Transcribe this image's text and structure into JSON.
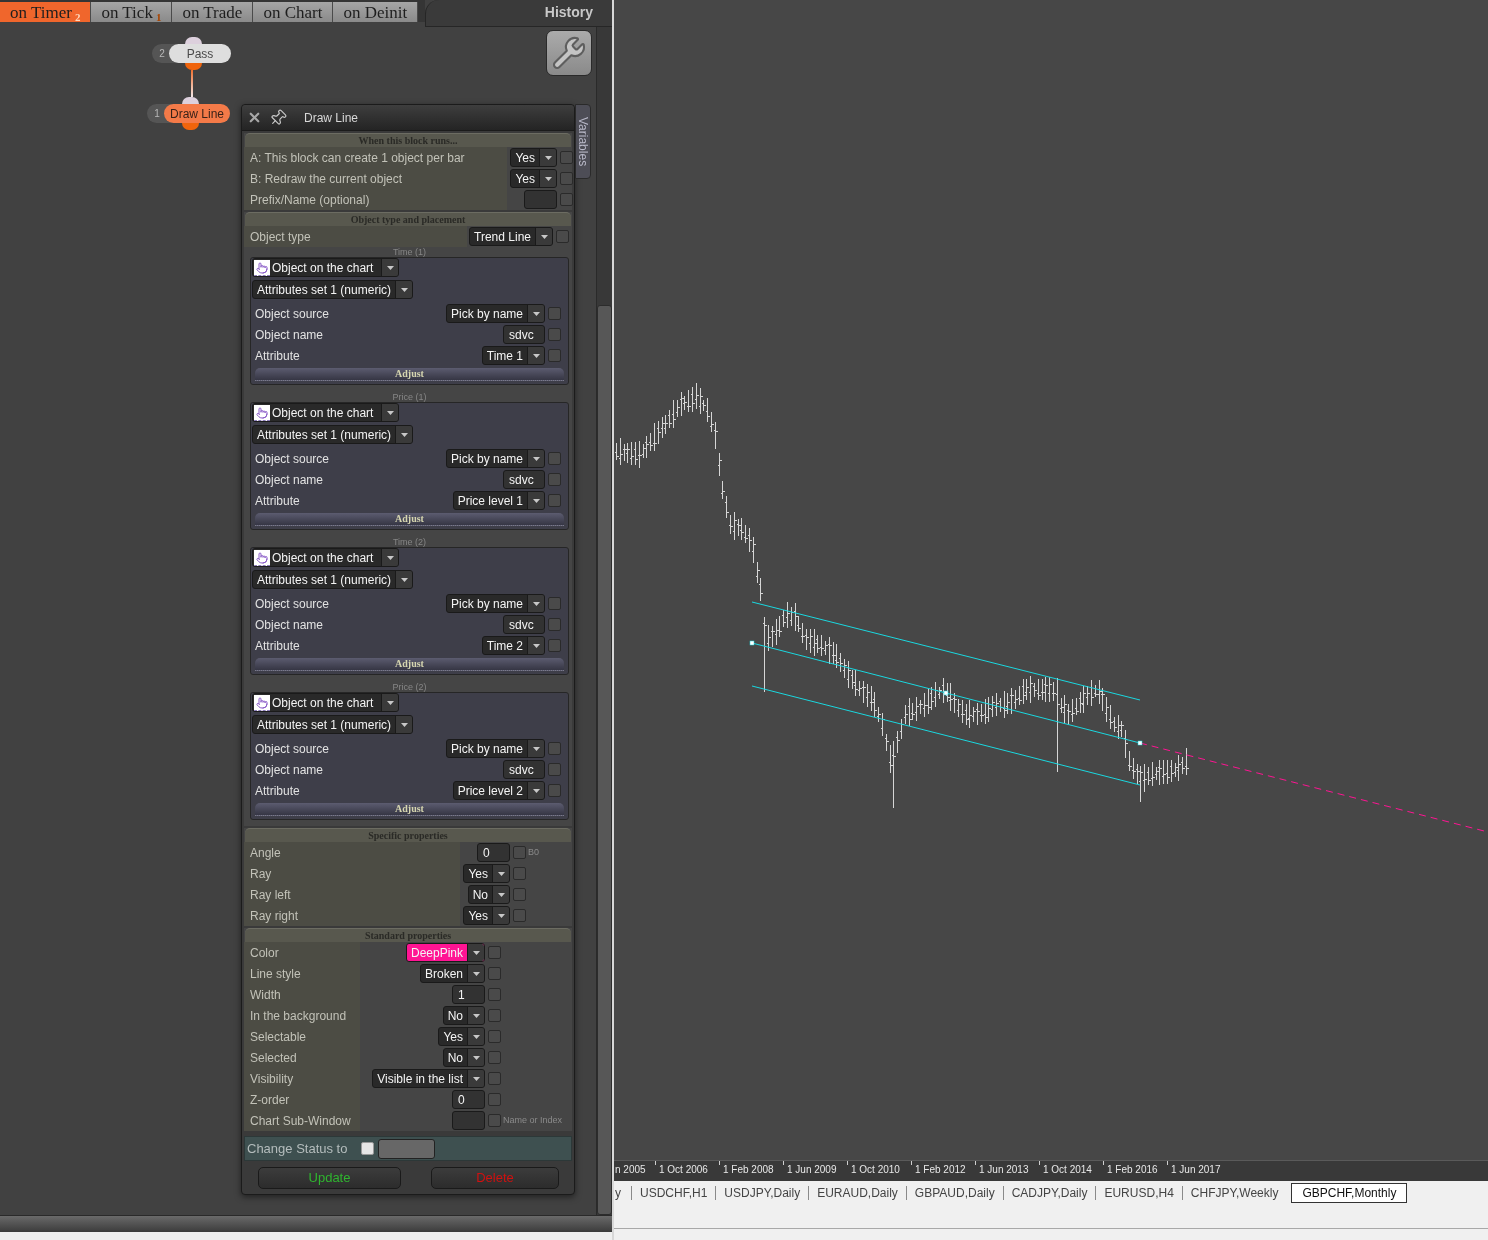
{
  "event_tabs": [
    {
      "label": "on Timer",
      "count": "2",
      "selected": true
    },
    {
      "label": "on Tick",
      "count": "1",
      "selected": false
    },
    {
      "label": "on Trade",
      "selected": false
    },
    {
      "label": "on Chart",
      "selected": false
    },
    {
      "label": "on Deinit",
      "selected": false
    }
  ],
  "history": {
    "title": "History"
  },
  "flow_nodes": [
    {
      "number": "2",
      "label": "Pass",
      "selected": false
    },
    {
      "number": "1",
      "label": "Draw Line",
      "selected": true
    }
  ],
  "block_panel": {
    "title": "Draw Line",
    "side_tab": "Variables",
    "sections": [
      {
        "title": "When this block runs...",
        "rows": [
          {
            "kind": "dropdown",
            "label": "A: This block can create 1 object per bar",
            "value": "Yes",
            "checked": false
          },
          {
            "kind": "dropdown",
            "label": "B: Redraw the current object",
            "value": "Yes",
            "checked": false
          },
          {
            "kind": "input",
            "label": "Prefix/Name (optional)",
            "checked": false
          }
        ]
      },
      {
        "title": "Object type and placement",
        "rows": [
          {
            "kind": "dropdown",
            "label": "Object type",
            "value": "Trend Line",
            "checked": false
          }
        ],
        "groups": [
          {
            "caption": "Time (1)",
            "source": "Object on the chart",
            "set": "Attributes set 1 (numeric)",
            "rows": [
              {
                "kind": "dropdown",
                "label": "Object source",
                "value": "Pick by name",
                "checked": false
              },
              {
                "kind": "input",
                "label": "Object name",
                "value": "sdvc",
                "checked": false
              },
              {
                "kind": "dropdown",
                "label": "Attribute",
                "value": "Time 1",
                "checked": false
              }
            ],
            "action": "Adjust"
          },
          {
            "caption": "Price (1)",
            "source": "Object on the chart",
            "set": "Attributes set 1 (numeric)",
            "rows": [
              {
                "kind": "dropdown",
                "label": "Object source",
                "value": "Pick by name",
                "checked": false
              },
              {
                "kind": "input",
                "label": "Object name",
                "value": "sdvc",
                "checked": false
              },
              {
                "kind": "dropdown",
                "label": "Attribute",
                "value": "Price level 1",
                "checked": false
              }
            ],
            "action": "Adjust"
          },
          {
            "caption": "Time (2)",
            "source": "Object on the chart",
            "set": "Attributes set 1 (numeric)",
            "rows": [
              {
                "kind": "dropdown",
                "label": "Object source",
                "value": "Pick by name",
                "checked": false
              },
              {
                "kind": "input",
                "label": "Object name",
                "value": "sdvc",
                "checked": false
              },
              {
                "kind": "dropdown",
                "label": "Attribute",
                "value": "Time 2",
                "checked": false
              }
            ],
            "action": "Adjust"
          },
          {
            "caption": "Price (2)",
            "source": "Object on the chart",
            "set": "Attributes set 1 (numeric)",
            "rows": [
              {
                "kind": "dropdown",
                "label": "Object source",
                "value": "Pick by name",
                "checked": false
              },
              {
                "kind": "input",
                "label": "Object name",
                "value": "sdvc",
                "checked": false
              },
              {
                "kind": "dropdown",
                "label": "Attribute",
                "value": "Price level 2",
                "checked": false
              }
            ],
            "action": "Adjust"
          }
        ]
      },
      {
        "title": "Specific properties",
        "rows": [
          {
            "kind": "input",
            "label": "Angle",
            "value": "0",
            "checked": false,
            "hint": "B0"
          },
          {
            "kind": "dropdown",
            "label": "Ray",
            "value": "Yes",
            "checked": false
          },
          {
            "kind": "dropdown",
            "label": "Ray left",
            "value": "No",
            "checked": false
          },
          {
            "kind": "dropdown",
            "label": "Ray right",
            "value": "Yes",
            "checked": false
          }
        ]
      },
      {
        "title": "Standard properties",
        "rows": [
          {
            "kind": "dropdown",
            "label": "Color",
            "value": "DeepPink",
            "color": "#ff1493",
            "checked": false
          },
          {
            "kind": "dropdown",
            "label": "Line style",
            "value": "Broken",
            "checked": false
          },
          {
            "kind": "input",
            "label": "Width",
            "value": "1",
            "checked": false
          },
          {
            "kind": "dropdown",
            "label": "In the background",
            "value": "No",
            "checked": false
          },
          {
            "kind": "dropdown",
            "label": "Selectable",
            "value": "Yes",
            "checked": false
          },
          {
            "kind": "dropdown",
            "label": "Selected",
            "value": "No",
            "checked": false
          },
          {
            "kind": "dropdown",
            "label": "Visibility",
            "value": "Visible in the list",
            "checked": false
          },
          {
            "kind": "input",
            "label": "Z-order",
            "value": "0",
            "checked": false
          },
          {
            "kind": "input",
            "label": "Chart Sub-Window",
            "checked": false,
            "hint": "Name or Index"
          }
        ]
      }
    ],
    "status": {
      "label": "Change Status to",
      "checked": false
    },
    "buttons": [
      {
        "kind": "update",
        "label": "Update"
      },
      {
        "kind": "delete",
        "label": "Delete"
      }
    ]
  },
  "chart": {
    "time_axis": [
      "n 2005",
      "1 Oct 2006",
      "1 Feb 2008",
      "1 Jun 2009",
      "1 Oct 2010",
      "1 Feb 2012",
      "1 Jun 2013",
      "1 Oct 2014",
      "1 Feb 2016",
      "1 Jun 2017"
    ],
    "symbol_tabs": [
      {
        "label": "y",
        "selected": false
      },
      {
        "label": "USDCHF,H1",
        "selected": false
      },
      {
        "label": "USDJPY,Daily",
        "selected": false
      },
      {
        "label": "EURAUD,Daily",
        "selected": false
      },
      {
        "label": "GBPAUD,Daily",
        "selected": false
      },
      {
        "label": "CADJPY,Daily",
        "selected": false
      },
      {
        "label": "EURUSD,H4",
        "selected": false
      },
      {
        "label": "CHFJPY,Weekly",
        "selected": false
      },
      {
        "label": "GBPCHF,Monthly",
        "selected": true
      }
    ]
  }
}
